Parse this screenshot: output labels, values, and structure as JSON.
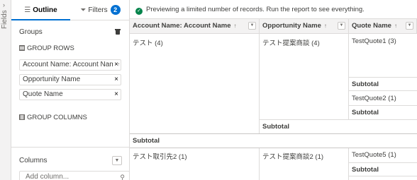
{
  "rail": {
    "label": "Fields",
    "chevron": "›"
  },
  "tabs": {
    "outline": {
      "icon": "☰",
      "label": "Outline"
    },
    "filters": {
      "icon": "⏷",
      "label": "Filters",
      "count": "2"
    }
  },
  "groups": {
    "title": "Groups",
    "rows_label": "GROUP ROWS",
    "rows": [
      {
        "label": "Account Name: Account Name"
      },
      {
        "label": "Opportunity Name"
      },
      {
        "label": "Quote Name"
      }
    ],
    "remove_glyph": "×",
    "columns_label": "GROUP COLUMNS"
  },
  "columns": {
    "title": "Columns",
    "add_placeholder": "Add column...",
    "search_icon": "⚲"
  },
  "notice": {
    "text": "Previewing a limited number of records. Run the report to see everything."
  },
  "table": {
    "headers": [
      {
        "label": "Account Name: Account Name",
        "sort": "↑"
      },
      {
        "label": "Opportunity Name",
        "sort": "↑"
      },
      {
        "label": "Quote Name",
        "sort": "↑"
      }
    ],
    "account1": "テスト (4)",
    "opp1": "テスト提案商談 (4)",
    "quote1": "TestQuote1 (3)",
    "subtotal_q1": "Subtotal",
    "quote2": "TestQuote2 (1)",
    "subtotal_q2": "Subtotal",
    "subtotal_opp1": "Subtotal",
    "subtotal_acc1": "Subtotal",
    "account2": "テスト取引先2 (1)",
    "opp2": "テスト提案商談2 (1)",
    "quote5": "TestQuote5 (1)",
    "subtotal_q5": "Subtotal"
  },
  "colors": {
    "accent": "#0070d2",
    "success": "#04844b",
    "border": "#dddbda",
    "header_bg": "#f3f2f2"
  }
}
